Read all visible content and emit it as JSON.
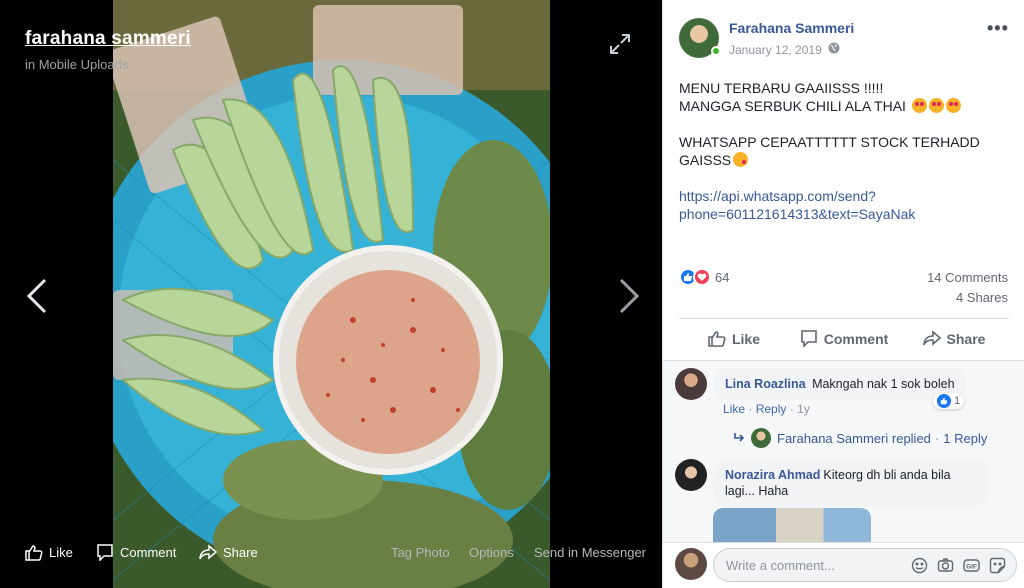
{
  "viewer": {
    "album_title": "farahana sammeri",
    "album_subtitle": "in Mobile Uploads",
    "actions": {
      "like": "Like",
      "comment": "Comment",
      "share": "Share",
      "tag_photo": "Tag Photo",
      "options": "Options",
      "send_messenger": "Send in Messenger"
    }
  },
  "post": {
    "author": "Farahana Sammeri",
    "date": "January 12, 2019",
    "line1": "MENU TERBARU GAAIISSS !!!!!",
    "line2": "MANGGA SERBUK CHILI ALA THAI",
    "line3": "WHATSAPP CEPAATTTTTT STOCK TERHADD",
    "line4": "GAISSS",
    "link_line1": "https://api.whatsapp.com/send?",
    "link_line2": "phone=601121614313&text=SayaNak",
    "reaction_count": "64",
    "comments_count": "14 Comments",
    "shares_count": "4 Shares",
    "like_label": "Like",
    "comment_label": "Comment",
    "share_label": "Share"
  },
  "comments": [
    {
      "name": "Lina Roazlina",
      "text": "Makngah nak 1 sok boleh",
      "like_label": "Like",
      "reply_label": "Reply",
      "age": "1y",
      "reaction_count": "1",
      "replied_by": "Farahana Sammeri replied",
      "reply_count": "1 Reply"
    },
    {
      "name": "Norazira Ahmad",
      "text_line1": "Kiteorg dh bli anda bila",
      "text_line2": "lagi... Haha"
    }
  ],
  "compose": {
    "placeholder": "Write a comment..."
  },
  "colors": {
    "link_blue": "#385898",
    "like_blue": "#1877f2",
    "love_red": "#f33e58",
    "online_green": "#42b72a"
  }
}
